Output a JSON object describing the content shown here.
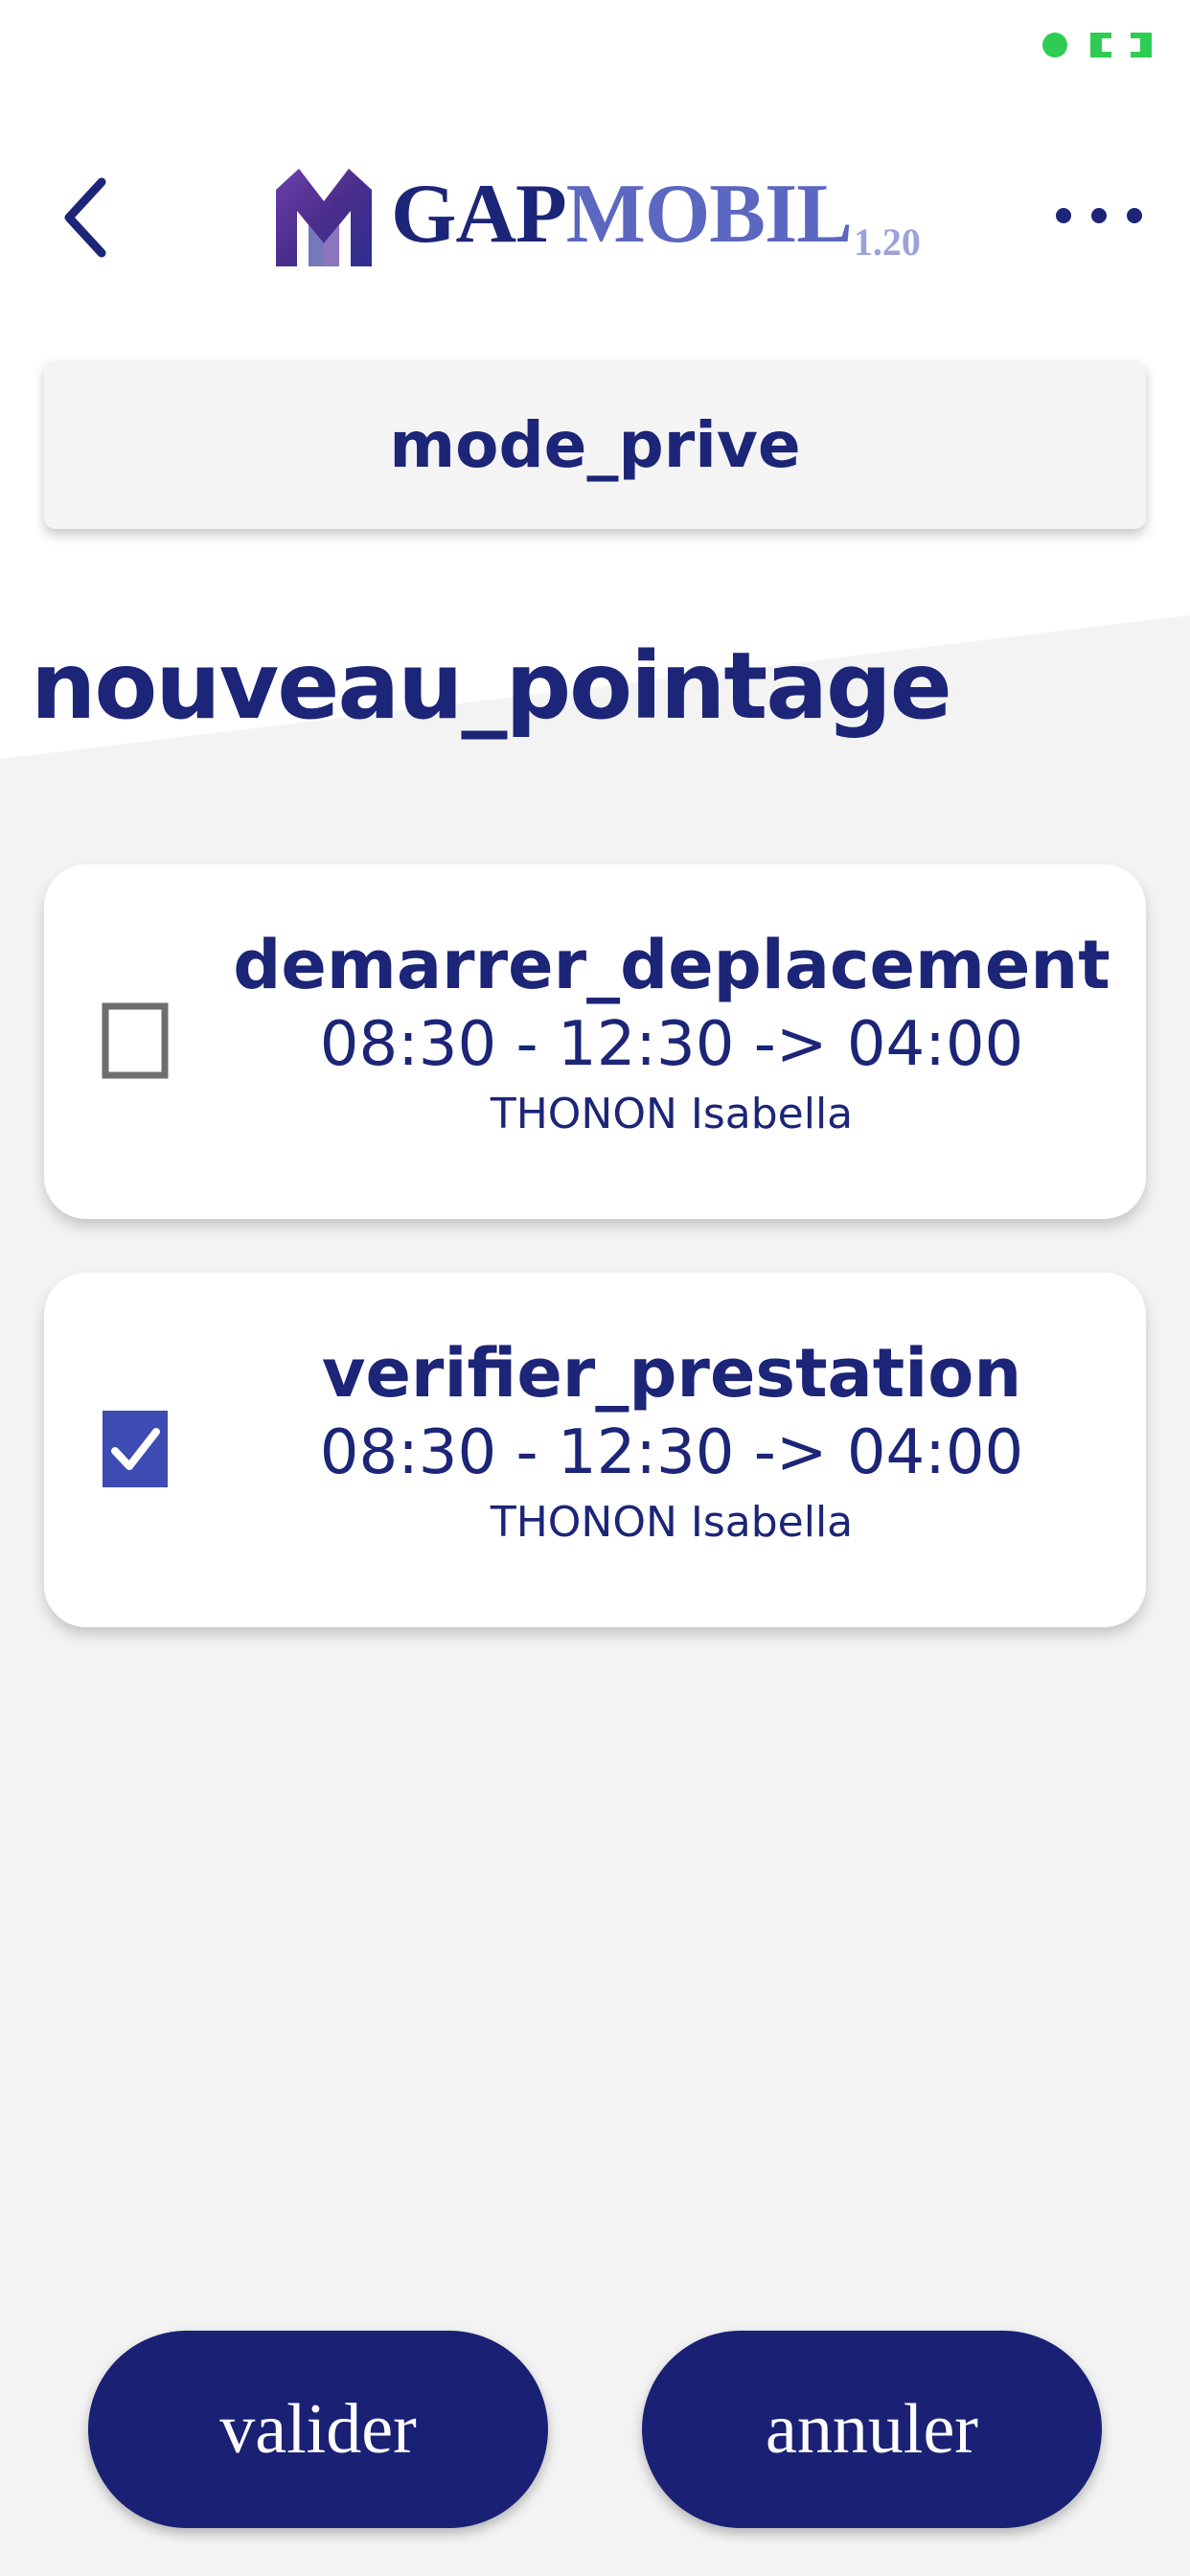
{
  "status_bar": {
    "icons": [
      "green-dot-icon",
      "screen-rotate-icon"
    ]
  },
  "header": {
    "back_icon": "chevron-left-icon",
    "logo": {
      "part1": "GAP",
      "part2": "MOBIL",
      "version": "1.20"
    },
    "more_icon": "ellipsis-icon"
  },
  "mode_button": {
    "label": "mode_prive"
  },
  "section_title": "nouveau_pointage",
  "tasks": [
    {
      "title": "demarrer_deplacement",
      "time": "08:30 - 12:30 -> 04:00",
      "person": "THONON Isabella",
      "checked": false
    },
    {
      "title": "verifier_prestation",
      "time": "08:30 - 12:30 -> 04:00",
      "person": "THONON Isabella",
      "checked": true
    }
  ],
  "actions": {
    "validate_label": "valider",
    "cancel_label": "annuler"
  },
  "colors": {
    "primary": "#1c2577",
    "button": "#1a2174",
    "accent_light": "#5b67c0",
    "checkbox_checked": "#3d4bb3",
    "checkbox_unchecked": "#6e6e6e",
    "background_grey": "#f3f3f3",
    "status_green": "#2ecc52"
  }
}
